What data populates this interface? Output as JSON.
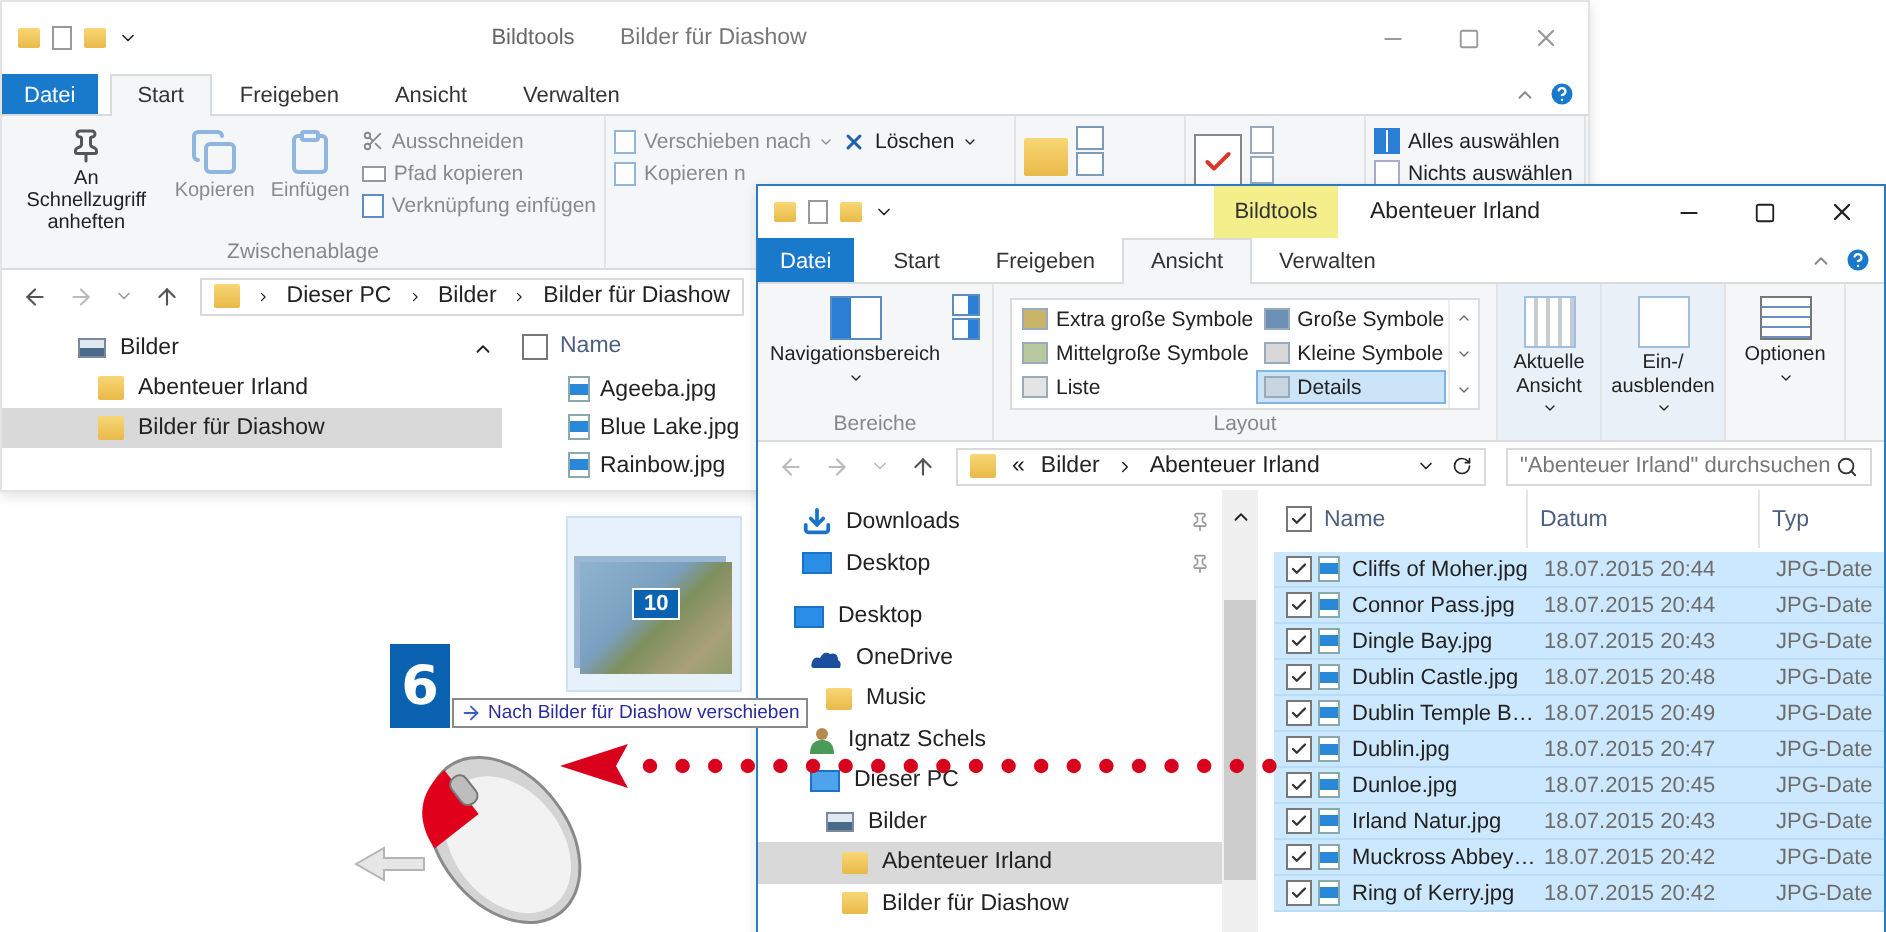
{
  "back_window": {
    "active": false,
    "context_tab": "Bildtools",
    "title": "Bilder für Diashow",
    "tabs": [
      {
        "label": "Datei",
        "kind": "file",
        "selected": false
      },
      {
        "label": "Start",
        "kind": "tab",
        "selected": true
      },
      {
        "label": "Freigeben",
        "kind": "tab",
        "selected": false
      },
      {
        "label": "Ansicht",
        "kind": "tab",
        "selected": false
      },
      {
        "label": "Verwalten",
        "kind": "tab",
        "selected": false
      }
    ],
    "ribbon": {
      "clipboard": {
        "large": [
          {
            "label": "An Schnellzugriff anheften",
            "disabled": false
          },
          {
            "label": "Kopieren",
            "disabled": true
          },
          {
            "label": "Einfügen",
            "disabled": true
          }
        ],
        "small": [
          {
            "label": "Ausschneiden",
            "disabled": true
          },
          {
            "label": "Pfad kopieren",
            "disabled": true
          },
          {
            "label": "Verknüpfung einfügen",
            "disabled": true
          }
        ],
        "group_label": "Zwischenablage"
      },
      "organize": {
        "move_to": {
          "label": "Verschieben nach",
          "disabled": true
        },
        "copy_to": {
          "label": "Kopieren n",
          "disabled": true
        },
        "delete": {
          "label": "Löschen",
          "disabled": false
        }
      },
      "select": {
        "select_all": "Alles auswählen",
        "select_none": "Nichts auswählen"
      }
    },
    "address": {
      "crumbs": [
        "Dieser PC",
        "Bilder",
        "Bilder für Diashow"
      ]
    },
    "nav": [
      {
        "label": "Bilder",
        "kind": "pictures",
        "selected": false,
        "children": [
          {
            "label": "Abenteuer Irland",
            "kind": "folder",
            "selected": false
          },
          {
            "label": "Bilder für Diashow",
            "kind": "folder",
            "selected": true
          }
        ]
      }
    ],
    "columns": [
      "Name"
    ],
    "header_checked": false,
    "files": [
      "Ageeba.jpg",
      "Blue Lake.jpg",
      "Rainbow.jpg"
    ]
  },
  "front_window": {
    "active": true,
    "context_tab": "Bildtools",
    "title": "Abenteuer Irland",
    "tabs": [
      {
        "label": "Datei",
        "kind": "file",
        "selected": false
      },
      {
        "label": "Start",
        "kind": "tab",
        "selected": false
      },
      {
        "label": "Freigeben",
        "kind": "tab",
        "selected": false
      },
      {
        "label": "Ansicht",
        "kind": "tab",
        "selected": true
      },
      {
        "label": "Verwalten",
        "kind": "tab",
        "selected": false
      }
    ],
    "ribbon": {
      "panes": {
        "navigation_pane": "Navigationsbereich",
        "group_label": "Bereiche"
      },
      "layout": {
        "options": [
          {
            "label": "Extra große Symbole",
            "selected": false
          },
          {
            "label": "Große Symbole",
            "selected": false
          },
          {
            "label": "Mittelgroße Symbole",
            "selected": false
          },
          {
            "label": "Kleine Symbole",
            "selected": false
          },
          {
            "label": "Liste",
            "selected": false
          },
          {
            "label": "Details",
            "selected": true
          }
        ],
        "group_label": "Layout"
      },
      "current_view": "Aktuelle Ansicht",
      "show_hide": "Ein-/ ausblenden",
      "options": "Optionen"
    },
    "address": {
      "overflow": "«",
      "crumbs": [
        "Bilder",
        "Abenteuer Irland"
      ]
    },
    "search": {
      "placeholder": "\"Abenteuer Irland\" durchsuchen"
    },
    "quick_access": [
      {
        "label": "Downloads",
        "kind": "download",
        "pinned": true
      },
      {
        "label": "Desktop",
        "kind": "desktop",
        "pinned": true
      }
    ],
    "nav": [
      {
        "label": "Desktop",
        "kind": "desktop",
        "selected": false,
        "children": [
          {
            "label": "OneDrive",
            "kind": "cloud",
            "selected": false,
            "children": [
              {
                "label": "Music",
                "kind": "folder",
                "selected": false
              }
            ]
          },
          {
            "label": "Ignatz Schels",
            "kind": "user",
            "selected": false
          },
          {
            "label": "Dieser PC",
            "kind": "pc",
            "selected": false,
            "children": [
              {
                "label": "Bilder",
                "kind": "pictures",
                "selected": false,
                "children": [
                  {
                    "label": "Abenteuer Irland",
                    "kind": "folder",
                    "selected": true
                  },
                  {
                    "label": "Bilder für Diashow",
                    "kind": "folder",
                    "selected": false
                  }
                ]
              }
            ]
          }
        ]
      }
    ],
    "columns": [
      "Name",
      "Datum",
      "Typ"
    ],
    "header_checked": true,
    "files": [
      {
        "name": "Cliffs of Moher.jpg",
        "date": "18.07.2015 20:44",
        "type": "JPG-Date",
        "checked": true,
        "selected": true
      },
      {
        "name": "Connor Pass.jpg",
        "date": "18.07.2015 20:44",
        "type": "JPG-Date",
        "checked": true,
        "selected": true
      },
      {
        "name": "Dingle Bay.jpg",
        "date": "18.07.2015 20:43",
        "type": "JPG-Date",
        "checked": true,
        "selected": true
      },
      {
        "name": "Dublin Castle.jpg",
        "date": "18.07.2015 20:48",
        "type": "JPG-Date",
        "checked": true,
        "selected": true
      },
      {
        "name": "Dublin Temple B…",
        "date": "18.07.2015 20:49",
        "type": "JPG-Date",
        "checked": true,
        "selected": true
      },
      {
        "name": "Dublin.jpg",
        "date": "18.07.2015 20:47",
        "type": "JPG-Date",
        "checked": true,
        "selected": true
      },
      {
        "name": "Dunloe.jpg",
        "date": "18.07.2015 20:45",
        "type": "JPG-Date",
        "checked": true,
        "selected": true
      },
      {
        "name": "Irland Natur.jpg",
        "date": "18.07.2015 20:43",
        "type": "JPG-Date",
        "checked": true,
        "selected": true
      },
      {
        "name": "Muckross Abbey…",
        "date": "18.07.2015 20:42",
        "type": "JPG-Date",
        "checked": true,
        "selected": true
      },
      {
        "name": "Ring of Kerry.jpg",
        "date": "18.07.2015 20:42",
        "type": "JPG-Date",
        "checked": true,
        "selected": true
      }
    ]
  },
  "drag": {
    "count": "10",
    "tooltip": "Nach Bilder für Diashow verschieben"
  },
  "step": {
    "number": "6"
  }
}
